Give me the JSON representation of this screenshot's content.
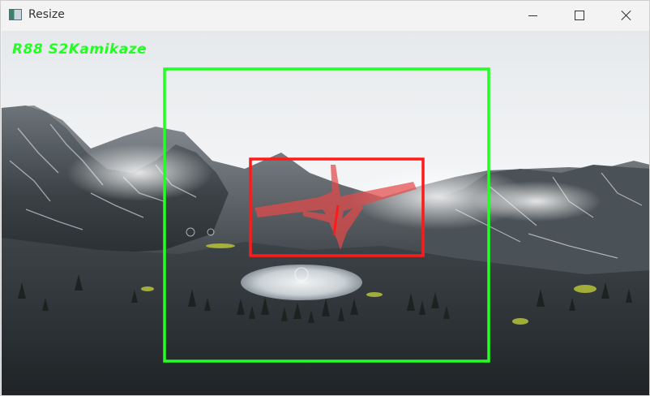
{
  "window": {
    "title": "Resize",
    "icon": "app-window-icon",
    "controls": [
      "minimize-icon",
      "maximize-icon",
      "close-icon"
    ]
  },
  "hud": {
    "label": "R88 S2Kamikaze",
    "detection_color": "#22ff22",
    "target_color": "#ff1a1a"
  },
  "scene": {
    "description_icon": "mountain-landscape-image",
    "object": "aircraft-icon"
  }
}
